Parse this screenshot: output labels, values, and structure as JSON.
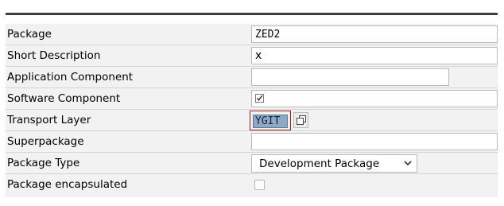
{
  "form": {
    "rows": [
      {
        "label": "Package",
        "value": "ZED2"
      },
      {
        "label": "Short Description",
        "value": "x"
      },
      {
        "label": "Application Component",
        "value": ""
      },
      {
        "label": "Software Component",
        "value": ""
      },
      {
        "label": "Transport Layer",
        "value": "YGIT"
      },
      {
        "label": "Superpackage",
        "value": ""
      },
      {
        "label": "Package Type",
        "value": "Development Package"
      },
      {
        "label": "Package encapsulated",
        "value": ""
      }
    ],
    "software_component_checked": true,
    "package_encapsulated_checked": false
  },
  "icons": {
    "f4_help": "value-help-icon",
    "dropdown": "chevron-down-icon",
    "checkbox": "checkmark-icon"
  },
  "colors": {
    "panel_background": "#f2f2f2",
    "selected_field": "#8fa8c4",
    "selected_border": "#9a1c1c"
  }
}
